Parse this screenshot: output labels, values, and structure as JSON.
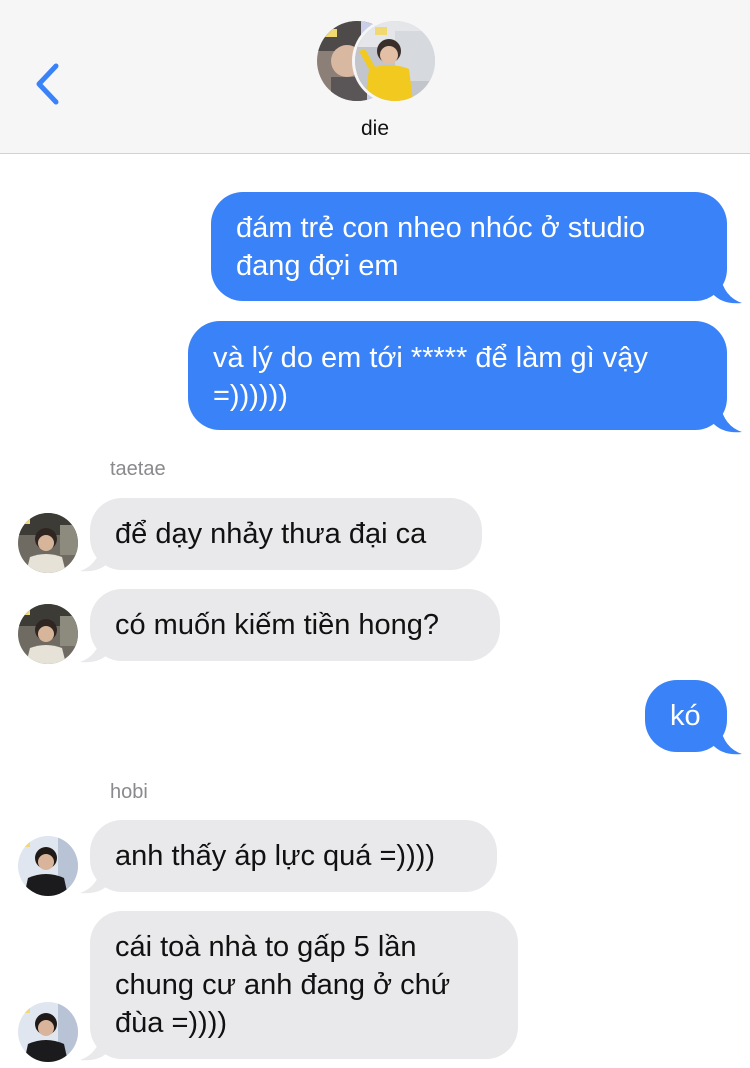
{
  "header": {
    "back_icon": "chevron-left-icon",
    "group_name": "die",
    "accent_color": "#3a82f7"
  },
  "colors": {
    "sent_bubble": "#3a82f7",
    "received_bubble": "#e9e9eb",
    "header_bg": "#f6f6f7"
  },
  "messages": [
    {
      "direction": "sent",
      "text": "đám trẻ con nheo nhóc ở studio đang đợi em"
    },
    {
      "direction": "sent",
      "text": "và lý do em tới ***** để làm gì vậy =))))))"
    },
    {
      "direction": "received",
      "sender": "taetae",
      "text": "để dạy nhảy thưa đại ca"
    },
    {
      "direction": "received",
      "sender": "taetae",
      "text": "có muốn kiếm tiền hong?"
    },
    {
      "direction": "sent",
      "text": "kó"
    },
    {
      "direction": "received",
      "sender": "hobi",
      "text": "anh thấy áp lực quá =))))"
    },
    {
      "direction": "received",
      "sender": "hobi",
      "text": "cái toà nhà to gấp 5 lần chung cư anh đang ở chứ đùa =))))"
    }
  ],
  "sender_labels": {
    "taetae": "taetae",
    "hobi": "hobi"
  }
}
